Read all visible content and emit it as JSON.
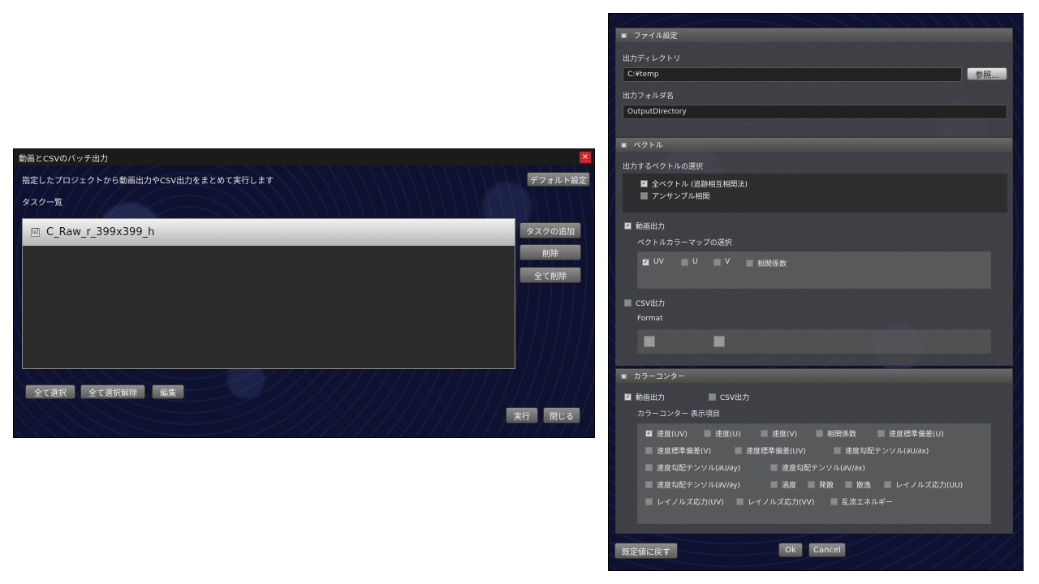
{
  "batch_dialog": {
    "title": "動画とCSVのバッチ出力",
    "close_glyph": "×",
    "description": "指定したプロジェクトから動画出力やCSV出力をまとめて実行します",
    "default_button": "デフォルト設定",
    "task_list_label": "タスク一覧",
    "tasks": [
      {
        "name": "C_Raw_r_399x399_h",
        "checked": "☑"
      }
    ],
    "side_buttons": {
      "add": "タスクの追加",
      "delete": "削除",
      "delete_all": "全て削除"
    },
    "bottom_buttons": {
      "select_all": "全て選択",
      "deselect_all": "全て選択解除",
      "edit": "編集"
    },
    "action_buttons": {
      "run": "実行",
      "close": "閉じる"
    }
  },
  "settings": {
    "file_section": {
      "title": "ファイル設定",
      "output_dir_label": "出力ディレクトリ",
      "output_dir_value": "C:¥temp",
      "browse_button": "参照...",
      "output_folder_label": "出力フォルダ名",
      "output_folder_value": "OutputDirectory"
    },
    "vector_section": {
      "title": "ベクトル",
      "select_label": "出力するベクトルの選択",
      "all_vectors": "全ベクトル (追跡相互相関法)",
      "ensemble": "アンサンブル相関",
      "video_output": "動画出力",
      "colormap_label": "ベクトルカラーマップの選択",
      "colormap_options": [
        "UV",
        "U",
        "V",
        "相関係数"
      ],
      "csv_output": "CSV出力",
      "format_label": "Format"
    },
    "contour_section": {
      "title": "カラーコンター",
      "video_output": "動画出力",
      "csv_output": "CSV出力",
      "display_items_label": "カラーコンター 表示項目",
      "items_row1": [
        "速度(UV)",
        "速度(U)",
        "速度(V)",
        "相関係数",
        "速度標準偏差(U)"
      ],
      "items_row2": [
        "速度標準偏差(V)",
        "速度標準偏差(UV)",
        "速度勾配テンソル(∂U/∂x)"
      ],
      "items_row3": [
        "速度勾配テンソル(∂U/∂y)",
        "速度勾配テンソル(∂V/∂x)"
      ],
      "items_row4": [
        "速度勾配テンソル(∂V/∂y)",
        "渦度",
        "発散",
        "散逸",
        "レイノルズ応力(UU)"
      ],
      "items_row5": [
        "レイノルズ応力(UV)",
        "レイノルズ応力(VV)",
        "乱流エネルギー"
      ]
    },
    "footer": {
      "reset_button": "既定値に戻す",
      "ok_button": "Ok",
      "cancel_button": "Cancel"
    },
    "check_glyph": "✓"
  }
}
